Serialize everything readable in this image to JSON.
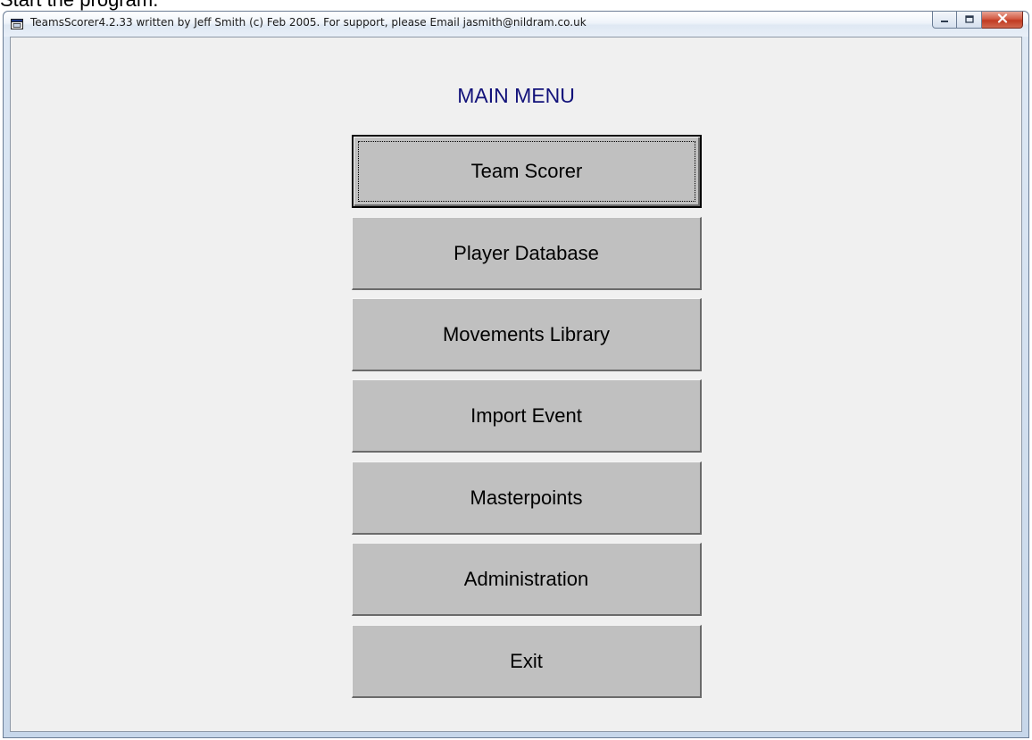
{
  "caption": "Start the program.",
  "window": {
    "title": "TeamsScorer4.2.33 written by Jeff Smith (c) Feb 2005.  For support, please Email jasmith@nildram.co.uk",
    "icons": {
      "app": "app-window-icon",
      "minimize": "minimize-icon",
      "maximize": "maximize-icon",
      "close": "close-icon"
    }
  },
  "menu": {
    "title": "MAIN MENU",
    "buttons": [
      {
        "label": "Team Scorer",
        "focused": true
      },
      {
        "label": "Player Database"
      },
      {
        "label": "Movements Library"
      },
      {
        "label": "Import Event"
      },
      {
        "label": "Masterpoints"
      },
      {
        "label": "Administration"
      },
      {
        "label": "Exit"
      }
    ]
  }
}
